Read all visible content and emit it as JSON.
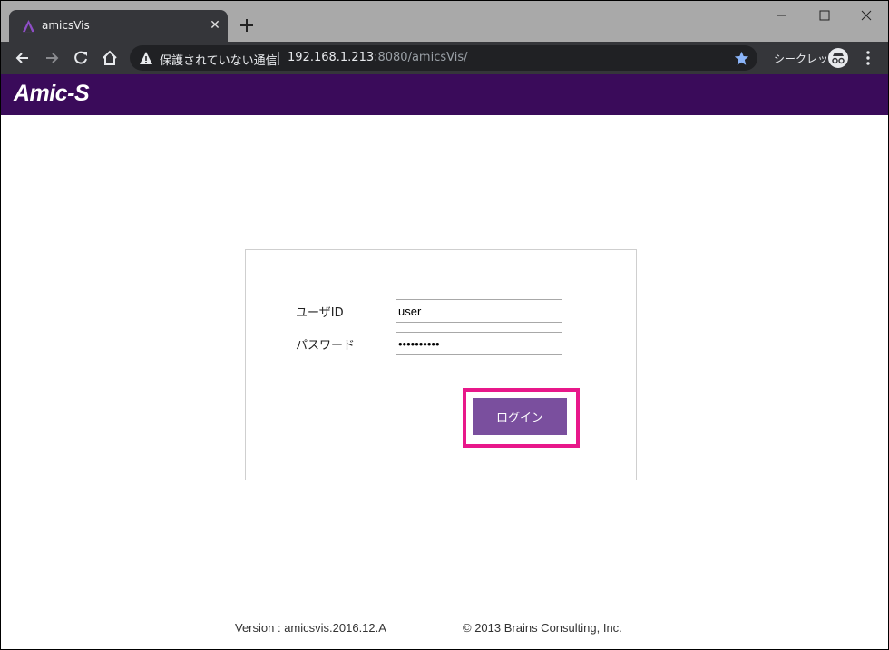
{
  "browser": {
    "tab": {
      "title": "amicsVis",
      "favicon": "amics-favicon-icon"
    },
    "new_tab_icon": "plus-icon",
    "window_controls": [
      "minimize-icon",
      "maximize-icon",
      "close-icon"
    ],
    "nav_icons": [
      "back-arrow-icon",
      "forward-arrow-icon",
      "reload-icon",
      "home-icon"
    ],
    "omnibox": {
      "security_label": "保護されていない通信",
      "url_host": "192.168.1.213",
      "url_rest": ":8080/amicsVis/",
      "warning_icon": "warning-triangle-icon",
      "bookmark_icon": "star-icon"
    },
    "incognito": {
      "label": "シークレット",
      "icon": "incognito-icon"
    },
    "menu_icon": "kebab-menu-icon"
  },
  "app": {
    "logo": "Amic-S",
    "colors": {
      "header": "#3a0b5a",
      "button": "#7a4f9e",
      "highlight": "#e8188a"
    }
  },
  "login": {
    "user_id_label": "ユーザID",
    "user_id_value": "user",
    "password_label": "パスワード",
    "password_value": "••••••••••",
    "submit_label": "ログイン"
  },
  "footer": {
    "version": "Version : amicsvis.2016.12.A",
    "copyright": "© 2013 Brains Consulting, Inc."
  }
}
